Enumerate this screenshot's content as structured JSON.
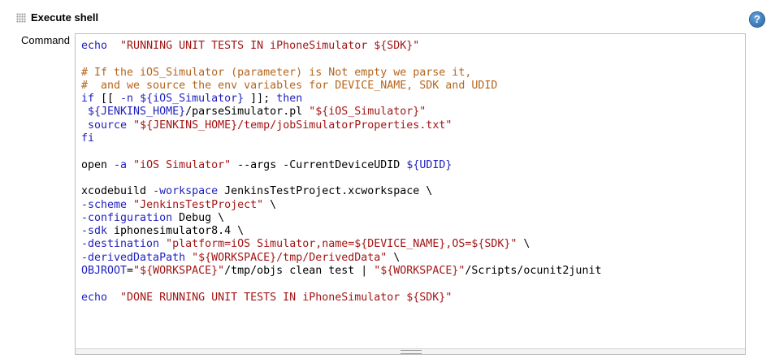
{
  "section": {
    "title": "Execute shell",
    "help_icon": "?"
  },
  "field": {
    "label": "Command"
  },
  "code_lines": [
    [
      [
        "kw",
        "echo"
      ],
      [
        "",
        "  "
      ],
      [
        "str",
        "\"RUNNING UNIT TESTS IN iPhoneSimulator ${SDK}\""
      ]
    ],
    [],
    [
      [
        "cmt",
        "# If the iOS_Simulator (parameter) is Not empty we parse it,"
      ]
    ],
    [
      [
        "cmt",
        "#  and we source the env variables for DEVICE_NAME, SDK and UDID"
      ]
    ],
    [
      [
        "kw",
        "if"
      ],
      [
        "",
        " [[ "
      ],
      [
        "opt",
        "-n"
      ],
      [
        "",
        " "
      ],
      [
        "var",
        "${iOS_Simulator}"
      ],
      [
        "",
        " ]]; "
      ],
      [
        "kw",
        "then"
      ]
    ],
    [
      [
        "",
        " "
      ],
      [
        "var",
        "${JENKINS_HOME}"
      ],
      [
        "",
        "/parseSimulator.pl "
      ],
      [
        "str",
        "\"${iOS_Simulator}\""
      ]
    ],
    [
      [
        "",
        " "
      ],
      [
        "kw",
        "source"
      ],
      [
        "",
        " "
      ],
      [
        "str",
        "\"${JENKINS_HOME}/temp/jobSimulatorProperties.txt\""
      ]
    ],
    [
      [
        "kw",
        "fi"
      ]
    ],
    [],
    [
      [
        "",
        "open "
      ],
      [
        "opt",
        "-a"
      ],
      [
        "",
        " "
      ],
      [
        "str",
        "\"iOS Simulator\""
      ],
      [
        "",
        " --args -CurrentDeviceUDID "
      ],
      [
        "var",
        "${UDID}"
      ]
    ],
    [],
    [
      [
        "",
        "xcodebuild "
      ],
      [
        "opt",
        "-workspace"
      ],
      [
        "",
        " JenkinsTestProject.xcworkspace \\"
      ]
    ],
    [
      [
        "opt",
        "-scheme"
      ],
      [
        "",
        " "
      ],
      [
        "str",
        "\"JenkinsTestProject\""
      ],
      [
        "",
        " \\"
      ]
    ],
    [
      [
        "opt",
        "-configuration"
      ],
      [
        "",
        " Debug \\"
      ]
    ],
    [
      [
        "opt",
        "-sdk"
      ],
      [
        "",
        " iphonesimulator8.4 \\"
      ]
    ],
    [
      [
        "opt",
        "-destination"
      ],
      [
        "",
        " "
      ],
      [
        "str",
        "\"platform=iOS Simulator,name=${DEVICE_NAME},OS=${SDK}\""
      ],
      [
        "",
        " \\"
      ]
    ],
    [
      [
        "opt",
        "-derivedDataPath"
      ],
      [
        "",
        " "
      ],
      [
        "str",
        "\"${WORKSPACE}/tmp/DerivedData\""
      ],
      [
        "",
        " \\"
      ]
    ],
    [
      [
        "var",
        "OBJROOT"
      ],
      [
        "",
        "="
      ],
      [
        "str",
        "\"${WORKSPACE}\""
      ],
      [
        "",
        "/tmp/objs clean test | "
      ],
      [
        "str",
        "\"${WORKSPACE}\""
      ],
      [
        "",
        "/Scripts/ocunit2junit"
      ]
    ],
    [],
    [
      [
        "kw",
        "echo"
      ],
      [
        "",
        "  "
      ],
      [
        "str",
        "\"DONE RUNNING UNIT TESTS IN iPhoneSimulator ${SDK}\""
      ]
    ]
  ]
}
